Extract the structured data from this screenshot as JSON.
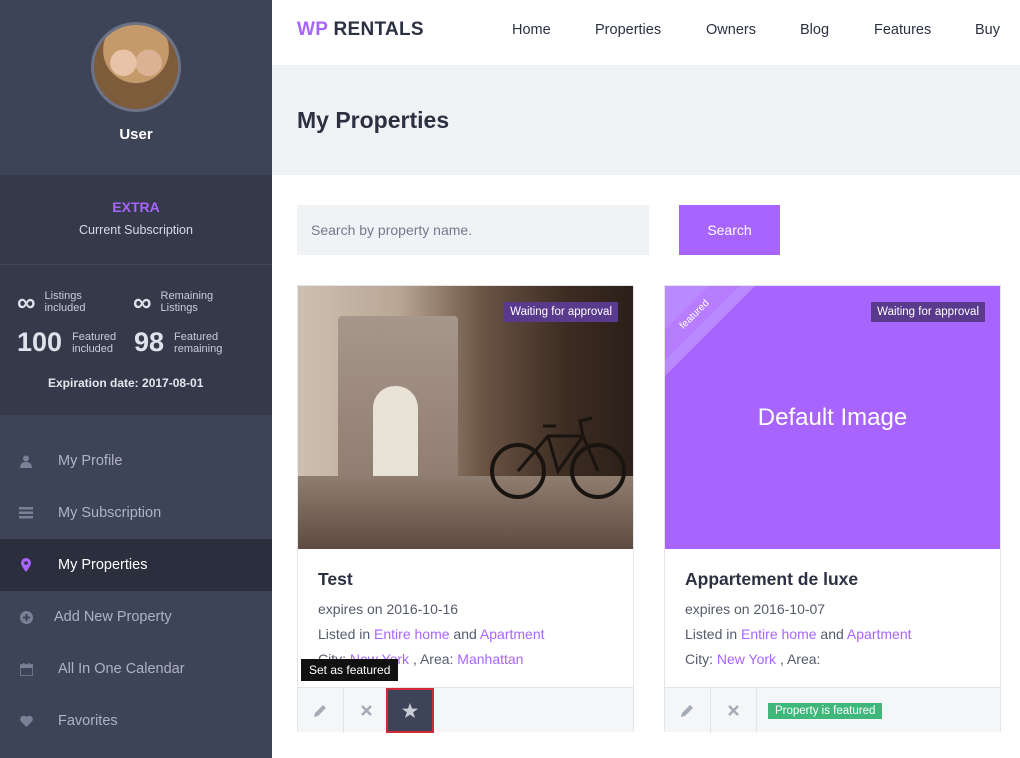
{
  "sidebar": {
    "user_name": "User",
    "subscription_plan": "EXTRA",
    "subscription_label": "Current Subscription",
    "stats": {
      "listings_included_value": "∞",
      "listings_included_label_1": "Listings",
      "listings_included_label_2": "included",
      "remaining_listings_value": "∞",
      "remaining_listings_label_1": "Remaining",
      "remaining_listings_label_2": "Listings",
      "featured_included_value": "100",
      "featured_included_label_1": "Featured",
      "featured_included_label_2": "included",
      "featured_remaining_value": "98",
      "featured_remaining_label_1": "Featured",
      "featured_remaining_label_2": "remaining"
    },
    "expiration": "Expiration date: 2017-08-01",
    "nav": [
      {
        "label": "My Profile",
        "icon": "user-icon"
      },
      {
        "label": "My Subscription",
        "icon": "list-icon"
      },
      {
        "label": "My Properties",
        "icon": "map-pin-icon"
      },
      {
        "label": "Add New Property",
        "icon": "plus-circle-icon"
      },
      {
        "label": "All In One Calendar",
        "icon": "calendar-icon"
      },
      {
        "label": "Favorites",
        "icon": "heart-icon"
      }
    ]
  },
  "header": {
    "logo_wp": "WP",
    "logo_rentals": "RENTALS",
    "menu": [
      "Home",
      "Properties",
      "Owners",
      "Blog",
      "Features",
      "Buy"
    ]
  },
  "page_title": "My Properties",
  "search": {
    "placeholder": "Search by property name.",
    "button_label": "Search"
  },
  "properties": [
    {
      "title": "Test",
      "badge": "Waiting for approval",
      "expires": "expires on 2016-10-16",
      "listed_prefix": "Listed in",
      "category": "Entire home",
      "and_text": "and",
      "type": "Apartment",
      "city_label": "City:",
      "city": "New York",
      "area_label": ", Area:",
      "area": "Manhattan",
      "tooltip": "Set as featured"
    },
    {
      "title": "Appartement de luxe",
      "badge": "Waiting for approval",
      "ribbon": "featured",
      "image_text": "Default Image",
      "expires": "expires on 2016-10-07",
      "listed_prefix": "Listed in",
      "category": "Entire home",
      "and_text": "and",
      "type": "Apartment",
      "city_label": "City:",
      "city": "New York",
      "area_label": ", Area:",
      "featured_status": "Property is featured"
    }
  ],
  "colors": {
    "accent": "#a864ff",
    "sidebar_bg": "#3e4457",
    "featured_green": "#3fb77a"
  }
}
